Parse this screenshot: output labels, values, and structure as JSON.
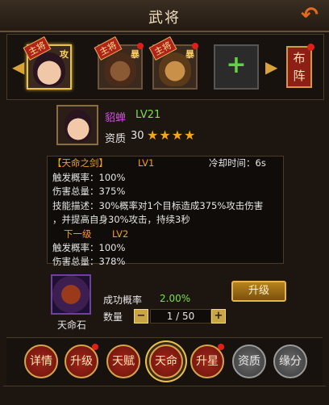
{
  "window": {
    "title": "武将",
    "back_icon": "return-arrow-icon"
  },
  "heroes": {
    "items": [
      {
        "tag": "主将",
        "type": "攻",
        "selected": true,
        "has_dot": false,
        "face_color": "#f0c8a8"
      },
      {
        "tag": "主将",
        "type": "暴",
        "selected": false,
        "has_dot": true,
        "face_color": "#7a5030"
      },
      {
        "tag": "主将",
        "type": "暴",
        "selected": false,
        "has_dot": true,
        "face_color": "#c89048"
      }
    ],
    "add_symbol": "+",
    "formation_label": [
      "布",
      "阵"
    ]
  },
  "hero_info": {
    "name": "貂蝉",
    "level": "LV21",
    "aptitude_label": "资质",
    "aptitude_value": "30",
    "stars": "★★★★"
  },
  "skill": {
    "name": "【天命之剑】",
    "level": "LV1",
    "cooldown": "冷却时间：6s",
    "trigger": "触发概率：100%",
    "damage": "伤害总量：375%",
    "desc_1": "技能描述：30%概率对1个目标造成375%攻击伤害",
    "desc_2": "，并提高自身30%攻击，持续3秒",
    "next_label": "下一级",
    "next_level": "LV2",
    "next_trigger": "触发概率：100%",
    "next_damage": "伤害总量：378%"
  },
  "upgrade": {
    "item_name": "天命石",
    "rate_label": "成功概率",
    "rate_value": "2.00%",
    "button_label": "升级",
    "qty_label": "数量",
    "minus": "−",
    "plus": "+",
    "qty_value": "1 / 50"
  },
  "tabs": [
    {
      "label": "详情",
      "style": "red",
      "dot": false
    },
    {
      "label": "升级",
      "style": "red",
      "dot": true
    },
    {
      "label": "天赋",
      "style": "red",
      "dot": false
    },
    {
      "label": "天命",
      "style": "red",
      "dot": false,
      "active": true
    },
    {
      "label": "升星",
      "style": "red",
      "dot": true
    },
    {
      "label": "资质",
      "style": "gray",
      "dot": false
    },
    {
      "label": "缘分",
      "style": "gray",
      "dot": false
    }
  ]
}
